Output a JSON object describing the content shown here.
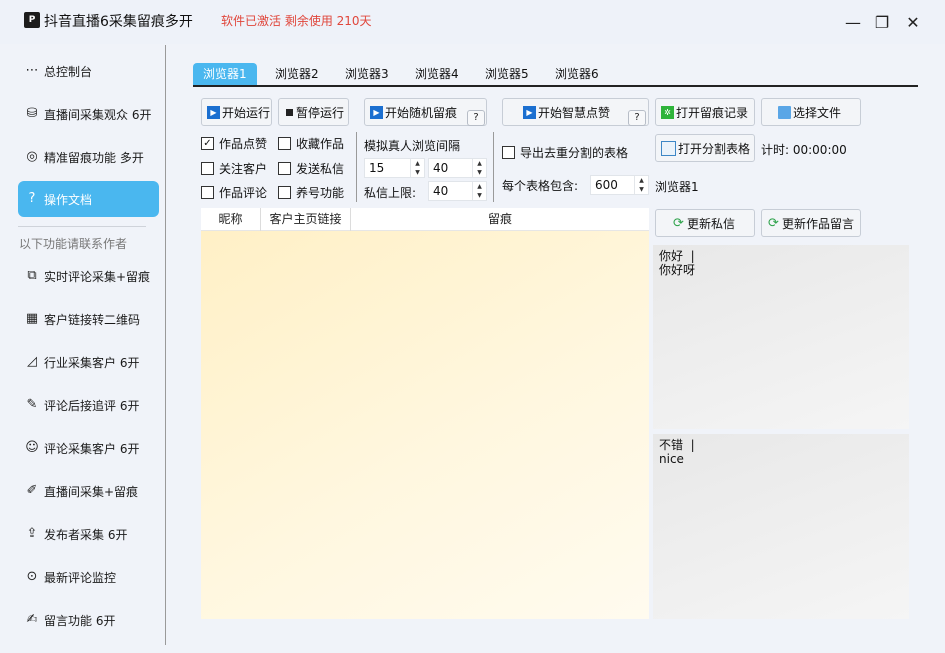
{
  "window": {
    "logo_text": "P",
    "title": "抖音直播6采集留痕多开",
    "status": "软件已激活 剩余使用 210天",
    "controls": {
      "minimize": "—",
      "maximize": "❐",
      "close": "✕"
    }
  },
  "sidebar": {
    "items": [
      {
        "label": "总控制台",
        "icon": "⋯"
      },
      {
        "label": "直播间采集观众 6开",
        "icon": "⛁"
      },
      {
        "label": "精准留痕功能 多开",
        "icon": "◎"
      },
      {
        "label": "操作文档",
        "icon": "?"
      }
    ],
    "section_title": "以下功能请联系作者",
    "extra_items": [
      {
        "label": "实时评论采集+留痕",
        "icon": "⧉"
      },
      {
        "label": "客户链接转二维码",
        "icon": "▦"
      },
      {
        "label": "行业采集客户 6开",
        "icon": "◿"
      },
      {
        "label": "评论后接追评 6开",
        "icon": "✎"
      },
      {
        "label": "评论采集客户 6开",
        "icon": "☺"
      },
      {
        "label": "直播间采集+留痕",
        "icon": "✐"
      },
      {
        "label": "发布者采集 6开",
        "icon": "⇪"
      },
      {
        "label": "最新评论监控",
        "icon": "⊙"
      },
      {
        "label": "留言功能 6开",
        "icon": "✍"
      }
    ],
    "active_index": 3
  },
  "tabs": [
    "浏览器1",
    "浏览器2",
    "浏览器3",
    "浏览器4",
    "浏览器5",
    "浏览器6"
  ],
  "toolbar": {
    "start": "开始运行",
    "pause": "暂停运行",
    "random_trace": "开始随机留痕",
    "smart_like": "开始智慧点赞",
    "open_record": "打开留痕记录",
    "choose_file": "选择文件",
    "open_split": "打开分割表格",
    "help": "?"
  },
  "options": {
    "like": {
      "label": "作品点赞",
      "checked": true
    },
    "favorite": {
      "label": "收藏作品",
      "checked": false
    },
    "follow": {
      "label": "关注客户",
      "checked": false
    },
    "send_dm": {
      "label": "发送私信",
      "checked": false
    },
    "comment": {
      "label": "作品评论",
      "checked": false
    },
    "nurture": {
      "label": "养号功能",
      "checked": false
    },
    "export_dedup": {
      "label": "导出去重分割的表格",
      "checked": false
    }
  },
  "interval": {
    "label": "模拟真人浏览间隔",
    "min": "15",
    "max": "40",
    "dm_limit_label": "私信上限:",
    "dm_limit": "40"
  },
  "split": {
    "rows_label": "每个表格包含:",
    "rows_value": "600",
    "browser_label": "浏览器1"
  },
  "timer": "计时: 00:00:00",
  "table": {
    "columns": [
      "昵称",
      "客户主页链接",
      "留痕"
    ]
  },
  "panels": {
    "update_dm": "更新私信",
    "update_comment": "更新作品留言",
    "dm_text": [
      "你好  |",
      "你好呀"
    ],
    "comment_text": [
      "不错  |",
      "nice"
    ]
  }
}
